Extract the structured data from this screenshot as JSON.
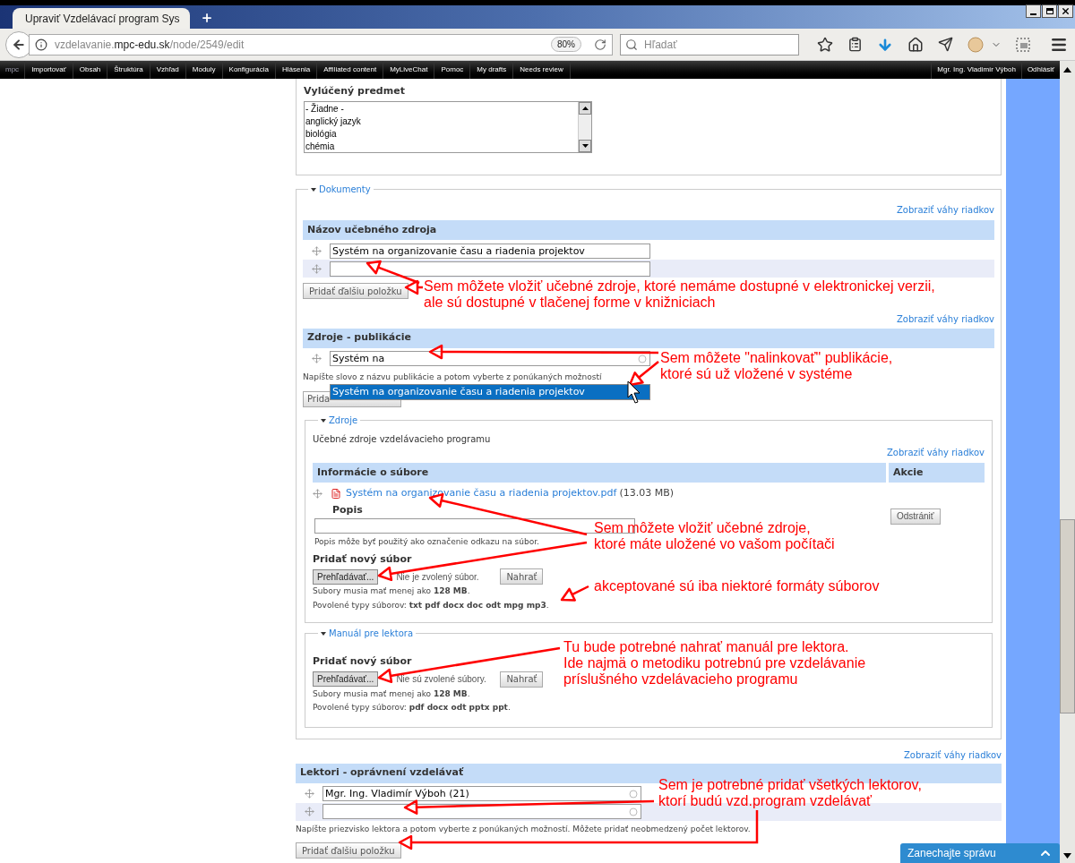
{
  "browser": {
    "tab": {
      "title": "Upraviť Vzdelávací program Sys",
      "selected": true
    },
    "url": {
      "subdomain": "vzdelavanie.",
      "domain": "mpc-edu.sk",
      "path": "/node/2549/edit"
    },
    "zoom": "80%",
    "search": {
      "placeholder": "Hľadať"
    }
  },
  "admin_toolbar": {
    "logo": "mpc",
    "items": [
      "Importovať",
      "Obsah",
      "Štruktúra",
      "Vzhľad",
      "Moduly",
      "Konfigurácia",
      "Hlásenia",
      "Affiliated content",
      "MyLiveChat",
      "Pomoc",
      "My drafts",
      "Needs review"
    ],
    "user": "Mgr. Ing. Vladimír Výboh",
    "logout": "Odhlásiť"
  },
  "excluded_subject": {
    "label": "Vylúčený predmet",
    "options": [
      {
        "label": "- Žiadne -",
        "selected": false
      },
      {
        "label": "anglický jazyk",
        "selected": false
      },
      {
        "label": "biológia",
        "selected": false
      },
      {
        "label": "chémia",
        "selected": false
      }
    ]
  },
  "documents": {
    "legend": "Dokumenty",
    "expanded": true,
    "resource_names": {
      "weights_link": "Zobraziť váhy riadkov",
      "heading": "Názov učebného zdroja",
      "fields": [
        {
          "kind": "filled",
          "value": "Systém na organizovanie času a riadenia projektov"
        },
        {
          "kind": "blank"
        }
      ],
      "add_button": "Pridať ďalšiu položku"
    },
    "publications": {
      "weights_link": "Zobraziť váhy riadkov",
      "heading": "Zdroje - publikácie",
      "field": {
        "kind": "filled",
        "value": "Systém na"
      },
      "help": "Napíšte slovo z názvu publikácie a potom vyberte z ponúkaných možností",
      "add_button": "Prida",
      "suggestions": [
        {
          "label": "Systém na organizovanie času a riadenia projektov",
          "selected": true
        }
      ]
    },
    "files": {
      "legend": "Zdroje",
      "expanded": true,
      "description": "Učebné zdroje vzdelávacieho programu",
      "weights_link": "Zobraziť váhy riadkov",
      "columns": [
        "Informácie o súbore",
        "Akcie"
      ],
      "file": {
        "name": "Systém na organizovanie času a riadenia projektov.pdf",
        "size": "(13.03 MB)",
        "description_label": "Popis",
        "description_help": "Popis môže byť použitý ako označenie odkazu na súbor.",
        "remove_button": "Odstrániť"
      },
      "upload": {
        "label": "Pridať nový súbor",
        "browse_button": "Prehľadávať...",
        "status": "Nie je zvolený súbor.",
        "upload_button": "Nahrať",
        "size_note": "Subory musia mať menej ako **128 MB**.",
        "types_note": "Povolené typy súborov: **txt pdf docx doc odt mpg mp3**."
      }
    },
    "manual": {
      "legend": "Manuál pre lektora",
      "expanded": true,
      "upload": {
        "label": "Pridať nový súbor",
        "browse_button": "Prehľadávať...",
        "status": "Nie sú zvolené súbory.",
        "upload_button": "Nahrať",
        "size_note": "Subory musia mať menej ako **128 MB**.",
        "types_note": "Povolené typy súborov: **pdf docx odt pptx ppt**."
      }
    }
  },
  "lecturers": {
    "weights_link": "Zobraziť váhy riadkov",
    "heading": "Lektori - oprávnení vzdelávať",
    "fields": [
      {
        "kind": "filled",
        "value": "Mgr. Ing. Vladimír Výboh (21)"
      },
      {
        "kind": "blank"
      }
    ],
    "help": "Napíšte priezvisko lektora a potom vyberte z ponúkaných možností. Môžete pridať neobmedzený počet lektorov.",
    "add_button": "Pridať ďalšiu položku"
  },
  "annotations": [
    {
      "lines": [
        "Sem môžete vložiť učebné zdroje, ktoré nemáme dostupné v elektronickej verzii,",
        "ale sú dostupné v tlačenej forme v knižniciach"
      ]
    },
    {
      "lines": [
        "Sem môžete \"nalinkovať\" publikácie,",
        "ktoré sú už vložené v systéme"
      ]
    },
    {
      "lines": [
        "Sem môžete vložiť učebné zdroje,",
        "ktoré máte uložené vo vašom počítači"
      ]
    },
    {
      "lines": [
        "akceptované sú iba niektoré formáty súborov"
      ]
    },
    {
      "lines": [
        "Tu bude potrebné nahrať manuál pre lektora.",
        "Ide najmä o metodiku potrebnú pre vzdelávanie",
        "príslušného vzdelávacieho programu"
      ]
    },
    {
      "lines": [
        "Sem je potrebné pridať všetkých lektorov,",
        "ktorí budú vzd.program vzdelávať"
      ]
    }
  ],
  "chat": {
    "label": "Zanechajte správu"
  }
}
